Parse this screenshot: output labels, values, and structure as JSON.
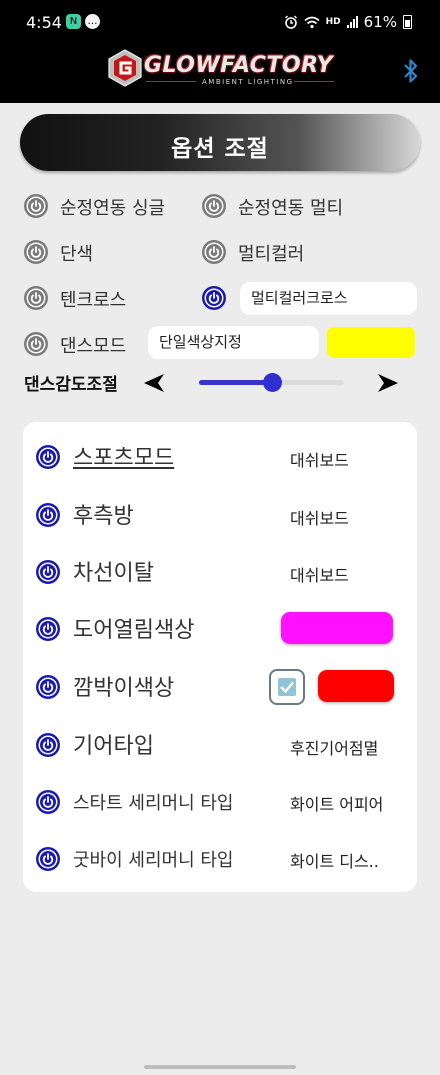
{
  "status": {
    "time": "4:54",
    "app_icon_1": "N",
    "app_icon_2": "…",
    "hd": "HD",
    "battery": "61%"
  },
  "header": {
    "logo_text": "GLOWFACTORY",
    "logo_sub": "AMBIENT LIGHTING",
    "bluetooth_icon": "bluetooth-icon"
  },
  "title": "옵션 조절",
  "options": {
    "single_sequential": "순정연동 싱글",
    "multi_sequential": "순정연동 멀티",
    "single_color": "단색",
    "multi_color": "멀티컬러",
    "ten_cross": "텐크로스",
    "multi_color_cross_value": "멀티컬러크로스",
    "dance_mode": "댄스모드",
    "dance_mode_value": "단일색상지정",
    "dance_color": "#ffff00"
  },
  "sensitivity": {
    "label": "댄스감도조절",
    "value_fraction": 0.5
  },
  "settings": [
    {
      "label": "스포츠모드",
      "value": "대쉬보드"
    },
    {
      "label": "후측방",
      "value": "대쉬보드"
    },
    {
      "label": "차선이탈",
      "value": "대쉬보드"
    },
    {
      "label": "도어열림색상",
      "color": "#ff10ff"
    },
    {
      "label": "깜박이색상",
      "color": "#ff0000",
      "checked": true
    },
    {
      "label": "기어타입",
      "value": "후진기어점멸"
    },
    {
      "label": "스타트 세리머니 타입",
      "value": "화이트 어피어"
    },
    {
      "label": "굿바이 세리머니 타입",
      "value": "화이트 디스.."
    }
  ],
  "colors": {
    "accent_blue": "#1a1ab0",
    "power_grey": "#7a7a7a"
  }
}
